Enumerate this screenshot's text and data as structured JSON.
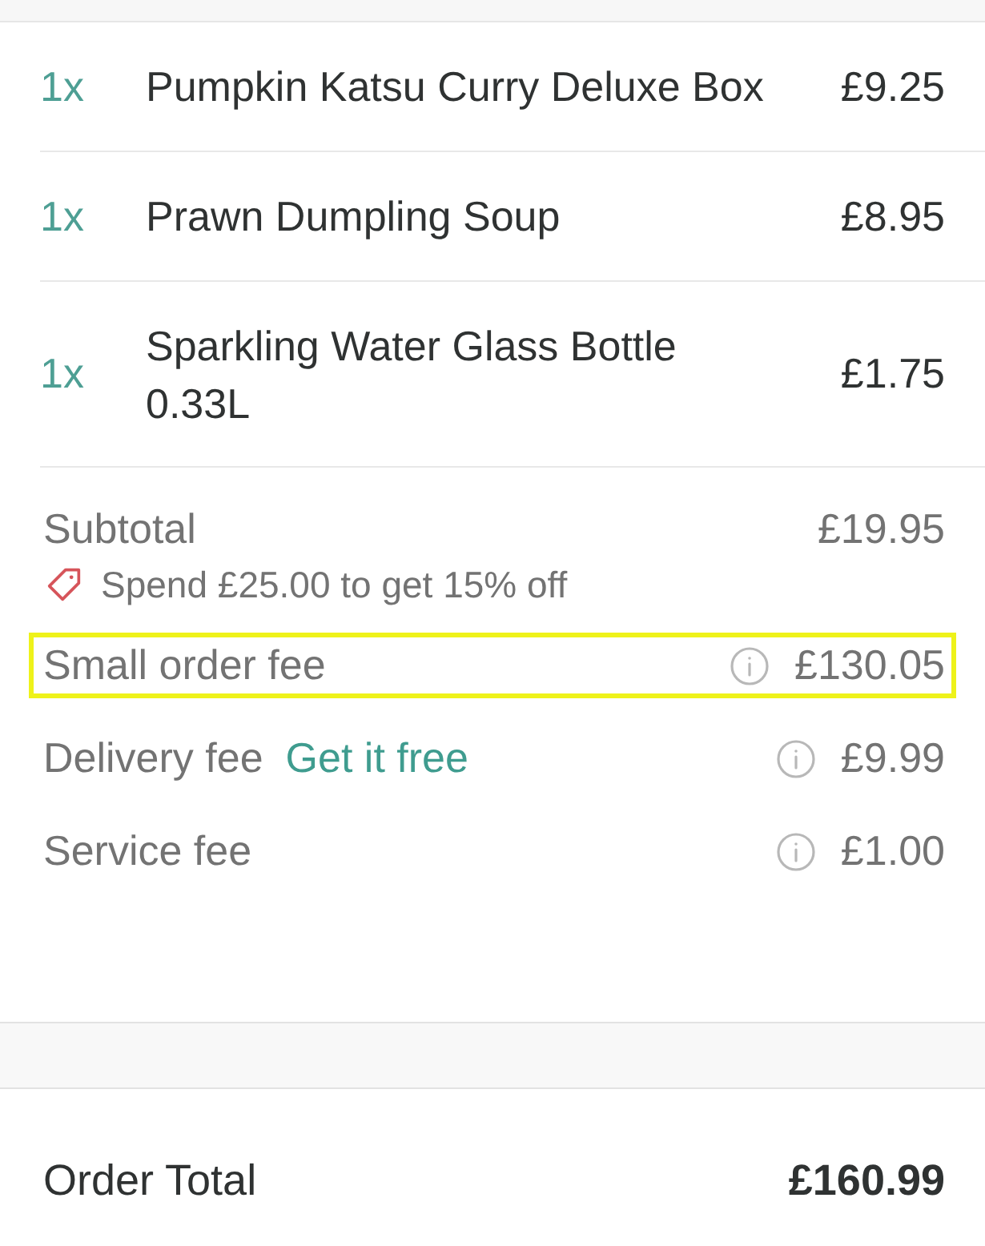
{
  "items": [
    {
      "quantity": "1x",
      "name": "Pumpkin Katsu Curry Deluxe Box",
      "price": "£9.25"
    },
    {
      "quantity": "1x",
      "name": "Prawn Dumpling Soup",
      "price": "£8.95"
    },
    {
      "quantity": "1x",
      "name": "Sparkling Water Glass Bottle 0.33L",
      "price": "£1.75"
    }
  ],
  "subtotal": {
    "label": "Subtotal",
    "amount": "£19.95",
    "promo": "Spend £25.00 to get 15% off"
  },
  "fees": [
    {
      "label": "Small order fee",
      "amount": "£130.05",
      "highlighted": true
    },
    {
      "label": "Delivery fee",
      "link": "Get it free",
      "amount": "£9.99",
      "highlighted": false
    },
    {
      "label": "Service fee",
      "amount": "£1.00",
      "highlighted": false
    }
  ],
  "total": {
    "label": "Order Total",
    "amount": "£160.99"
  }
}
